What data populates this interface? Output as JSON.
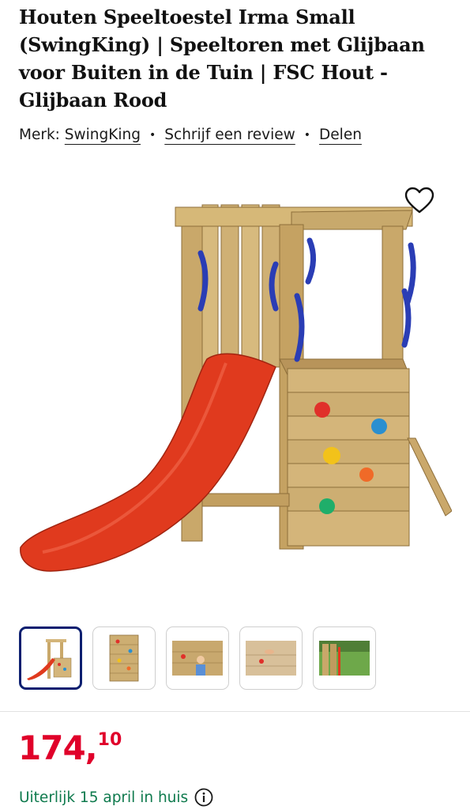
{
  "product": {
    "title": "Houten Speeltoestel Irma Small (SwingKing) | Speeltoren met Glijbaan voor Buiten in de Tuin | FSC Hout - Glijbaan Rood"
  },
  "meta": {
    "brand_prefix": "Merk:",
    "brand": "SwingKing",
    "separator": "•",
    "review_link": "Schrijf een review",
    "share_link": "Delen"
  },
  "icons": {
    "wishlist": "heart-icon",
    "info": "info-icon"
  },
  "thumbnails": {
    "count": 5,
    "active_index": 0
  },
  "price": {
    "euros": "174,",
    "cents": "10"
  },
  "delivery": {
    "text": "Uiterlijk 15 april in huis"
  },
  "colors": {
    "price": "#e0002a",
    "delivery": "#0e7a4d",
    "active_thumb_border": "#0b1f70",
    "slide": "#e03a1e",
    "handles": "#2a3db5"
  }
}
